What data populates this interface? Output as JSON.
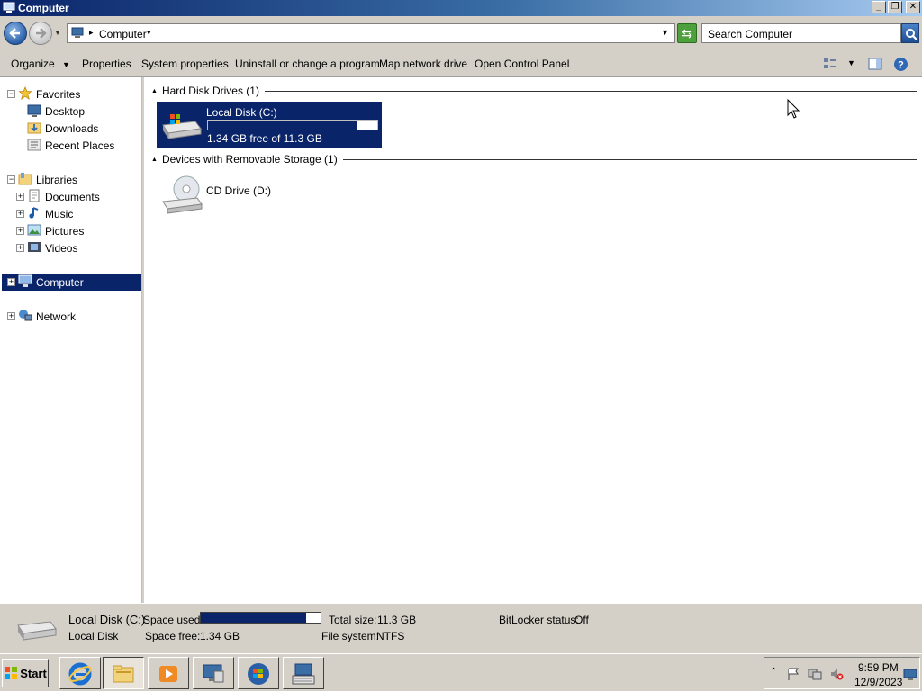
{
  "window": {
    "title": "Computer"
  },
  "address": {
    "crumb": "Computer",
    "search_placeholder": "Search Computer"
  },
  "commands": {
    "organize": "Organize",
    "properties": "Properties",
    "system_properties": "System properties",
    "uninstall": "Uninstall or change a program",
    "map_drive": "Map network drive",
    "control_panel": "Open Control Panel"
  },
  "nav": {
    "favorites": {
      "label": "Favorites",
      "items": [
        "Desktop",
        "Downloads",
        "Recent Places"
      ]
    },
    "libraries": {
      "label": "Libraries",
      "items": [
        "Documents",
        "Music",
        "Pictures",
        "Videos"
      ]
    },
    "computer": "Computer",
    "network": "Network"
  },
  "groups": {
    "hdd": {
      "title": "Hard Disk Drives (1)",
      "drive": {
        "name": "Local Disk (C:)",
        "free_text": "1.34 GB free of 11.3 GB",
        "used_fraction": 0.88
      }
    },
    "removable": {
      "title": "Devices with Removable Storage (1)",
      "drive": {
        "name": "CD Drive (D:)"
      }
    }
  },
  "details": {
    "name": "Local Disk (C:)",
    "type": "Local Disk",
    "space_used_label": "Space used:",
    "space_used_fraction": 0.88,
    "space_free_label": "Space free:",
    "space_free_value": "1.34 GB",
    "total_size_label": "Total size:",
    "total_size_value": "11.3 GB",
    "file_system_label": "File system:",
    "file_system_value": "NTFS",
    "bitlocker_label": "BitLocker status:",
    "bitlocker_value": "Off"
  },
  "taskbar": {
    "start": "Start",
    "apps": [
      "internet-explorer-icon",
      "windows-explorer-icon",
      "media-player-icon",
      "remote-desktop-icon",
      "windows-icon",
      "keyboard-icon"
    ],
    "clock_time": "9:59 PM",
    "clock_date": "12/9/2023"
  },
  "colors": {
    "selection": "#0a246a",
    "titlebar": "#0a246a",
    "face": "#d4d0c8"
  }
}
